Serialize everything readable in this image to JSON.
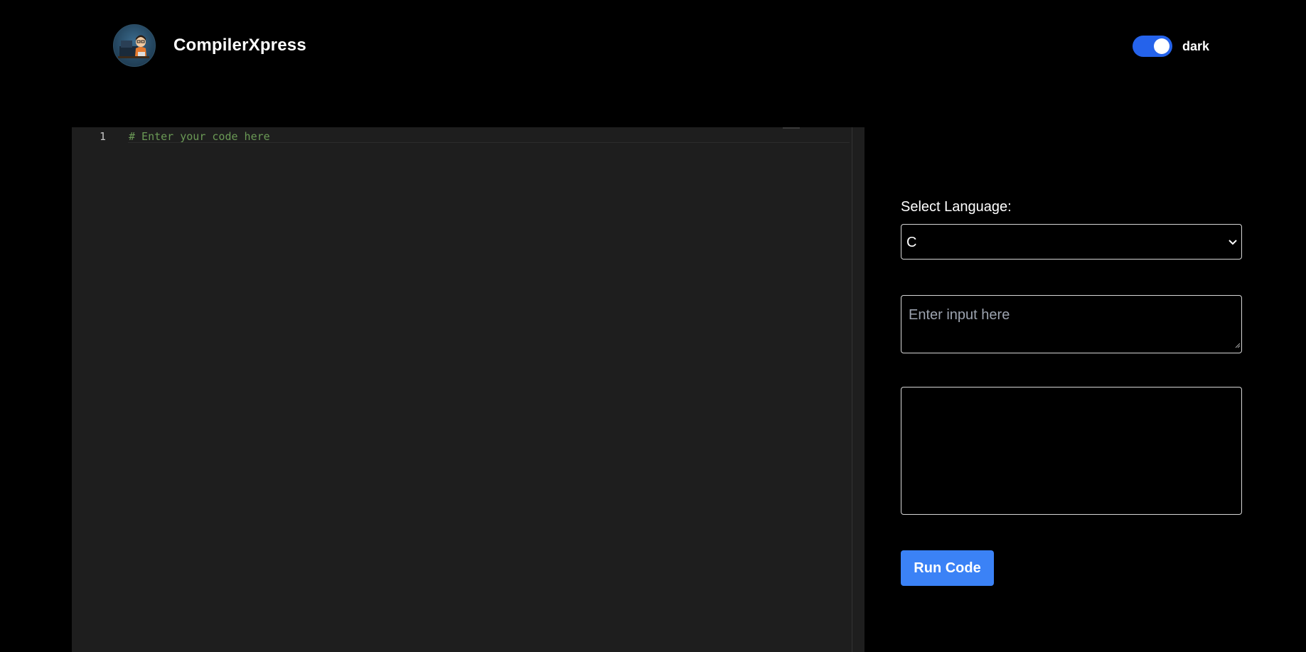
{
  "header": {
    "brand": "CompilerXpress",
    "theme_toggle": {
      "state": "on",
      "label": "dark"
    }
  },
  "editor": {
    "line_numbers": [
      "1"
    ],
    "lines": [
      "# Enter your code here"
    ]
  },
  "panel": {
    "language_label": "Select Language:",
    "language_value": "C",
    "input_placeholder": "Enter input here",
    "output_value": "",
    "run_label": "Run Code"
  },
  "colors": {
    "background": "#000000",
    "editor_background": "#1e1e1e",
    "comment": "#6a9955",
    "accent": "#3b82f6",
    "toggle": "#2563eb"
  },
  "icons": [
    "app-logo-avatar",
    "chevron-down-icon",
    "resize-handle-icon"
  ]
}
